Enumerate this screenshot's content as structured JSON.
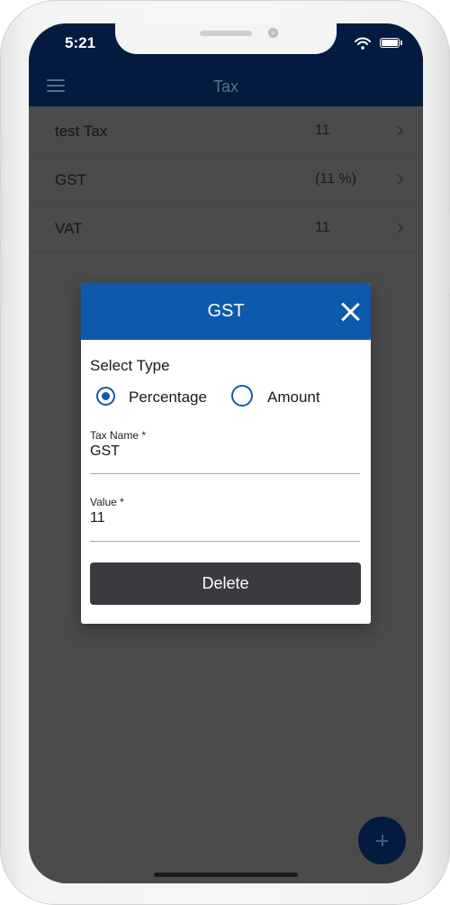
{
  "status_bar": {
    "time": "5:21"
  },
  "app_bar": {
    "title": "Tax"
  },
  "tax_list": [
    {
      "name": "test Tax",
      "value": "11"
    },
    {
      "name": "GST",
      "value": "(11 %)"
    },
    {
      "name": "VAT",
      "value": "11"
    }
  ],
  "dialog": {
    "title": "GST",
    "select_type_label": "Select Type",
    "options": [
      {
        "label": "Percentage",
        "selected": true
      },
      {
        "label": "Amount",
        "selected": false
      }
    ],
    "tax_name_label": "Tax Name *",
    "tax_name_value": "GST",
    "value_label": "Value *",
    "value_value": "11",
    "delete_label": "Delete"
  },
  "colors": {
    "app_bar": "#031b3f",
    "dialog_header": "#0d5aad",
    "radio_accent": "#1159a8",
    "delete_button": "#3a3b3e"
  },
  "icons": [
    "menu-icon",
    "chevron-right-icon",
    "close-icon",
    "plus-icon",
    "wifi-icon",
    "battery-icon"
  ]
}
